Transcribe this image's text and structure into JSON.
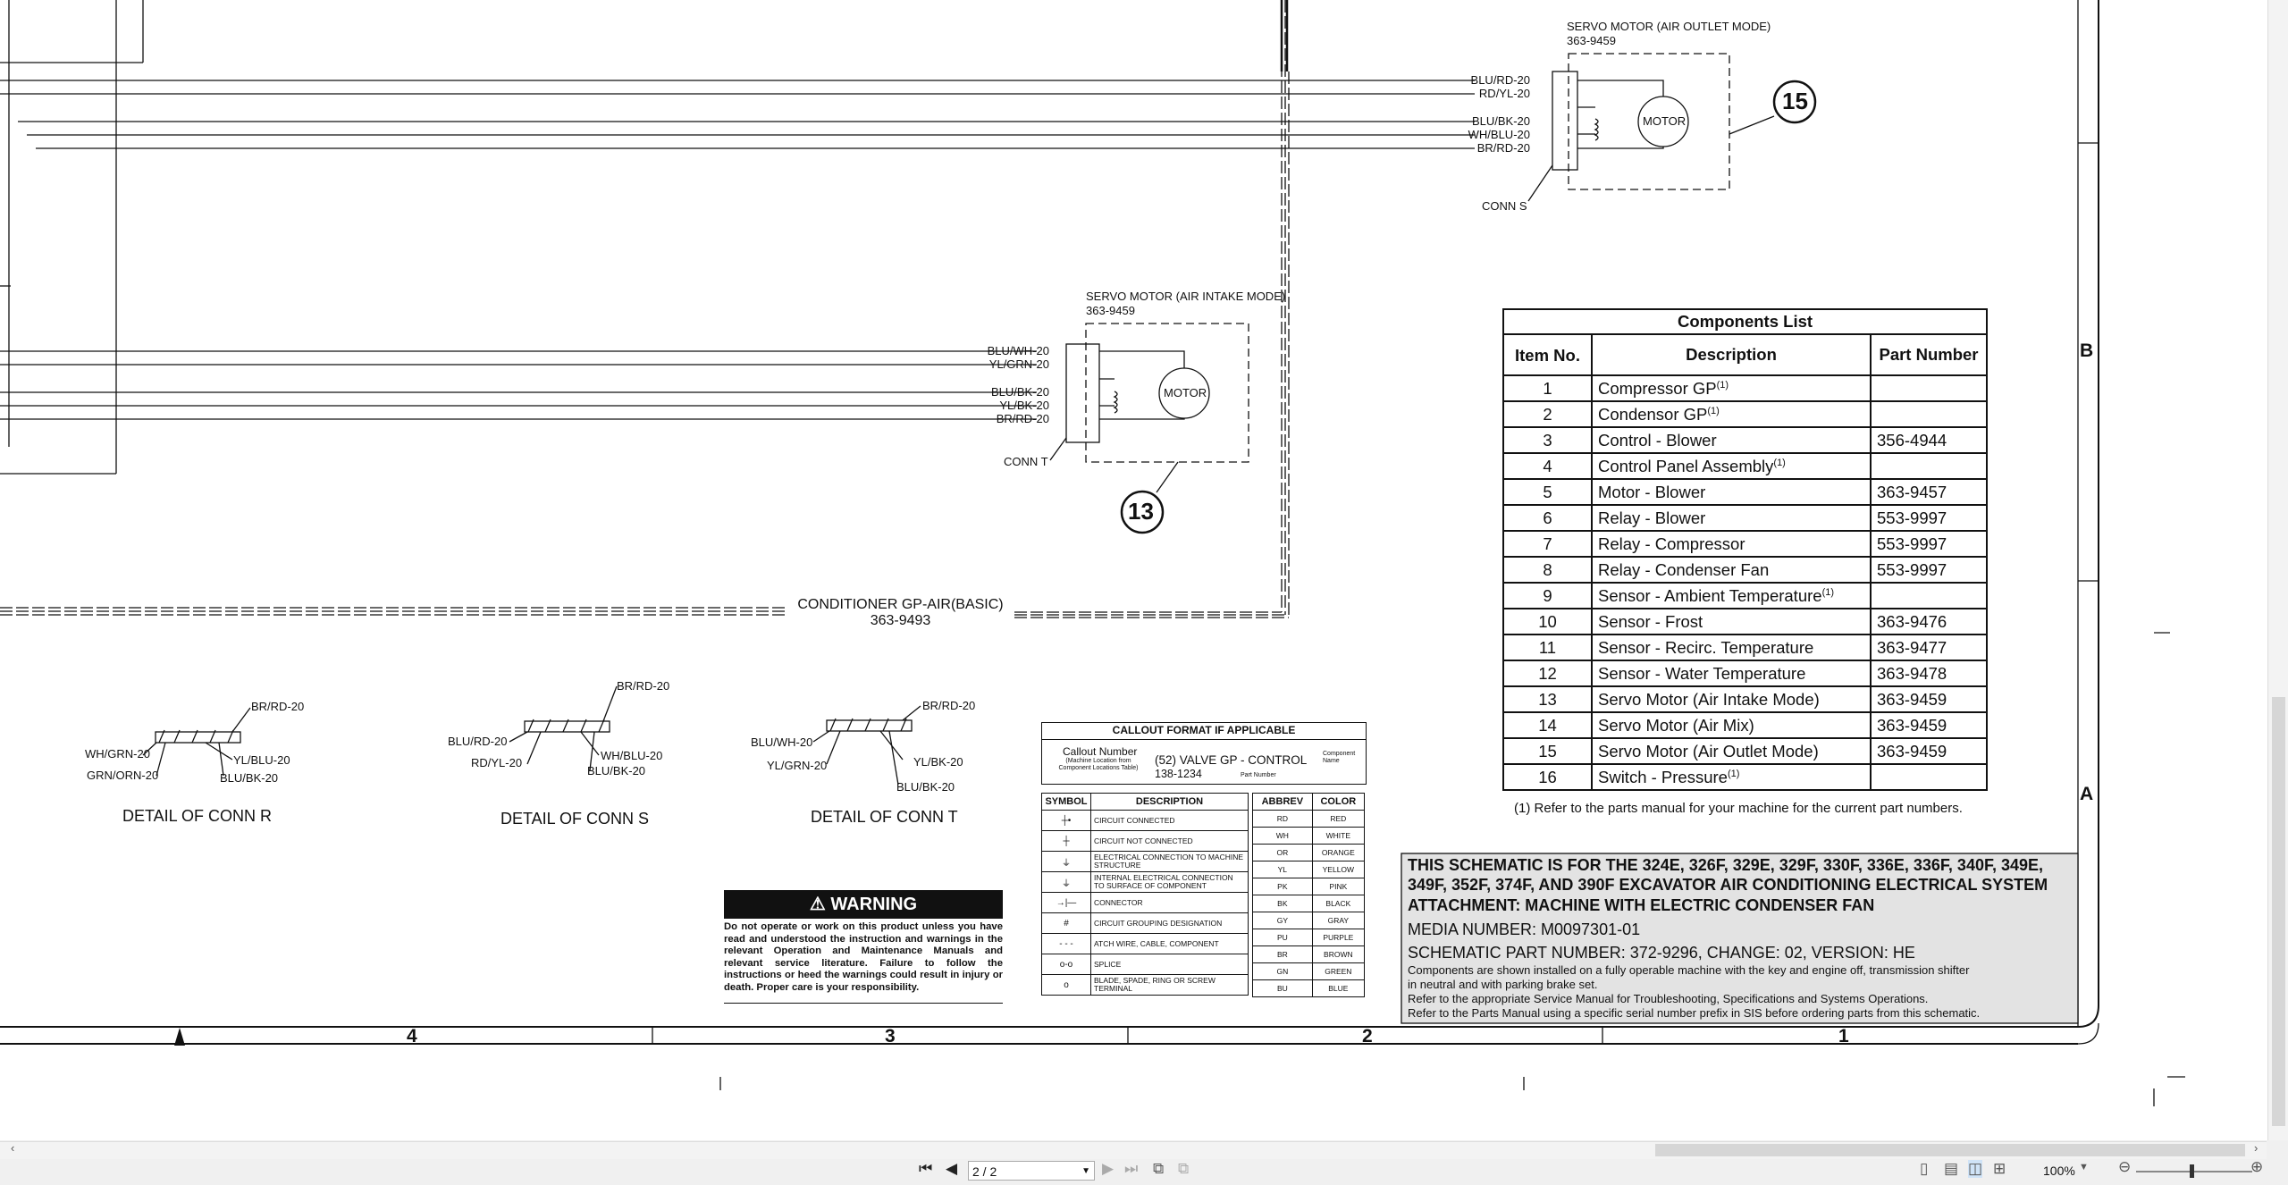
{
  "servo_outlet": {
    "title": "SERVO MOTOR (AIR OUTLET MODE)",
    "part": "363-9459",
    "wires": [
      "BLU/RD-20",
      "RD/YL-20",
      "BLU/BK-20",
      "WH/BLU-20",
      "BR/RD-20"
    ],
    "conn": "CONN S",
    "motor": "MOTOR",
    "callout": "15"
  },
  "servo_intake": {
    "title": "SERVO MOTOR (AIR INTAKE MODE)",
    "part": "363-9459",
    "wires": [
      "BLU/WH-20",
      "YL/GRN-20",
      "BLU/BK-20",
      "YL/BK-20",
      "BR/RD-20"
    ],
    "conn": "CONN T",
    "motor": "MOTOR",
    "callout": "13"
  },
  "conditioner": {
    "name": "CONDITIONER GP-AIR(BASIC)",
    "part": "363-9493"
  },
  "zone_labels": {
    "b": "B",
    "a": "A"
  },
  "column_numbers": [
    "4",
    "3",
    "2",
    "1"
  ],
  "details": {
    "r": {
      "title": "DETAIL OF CONN R",
      "wires": [
        "BR/RD-20",
        "WH/GRN-20",
        "YL/BLU-20",
        "GRN/ORN-20",
        "BLU/BK-20"
      ]
    },
    "s": {
      "title": "DETAIL OF CONN S",
      "wires": [
        "BR/RD-20",
        "BLU/RD-20",
        "WH/BLU-20",
        "RD/YL-20",
        "BLU/BK-20"
      ]
    },
    "t": {
      "title": "DETAIL OF CONN T",
      "wires": [
        "BR/RD-20",
        "BLU/WH-20",
        "YL/BK-20",
        "YL/GRN-20",
        "BLU/BK-20"
      ]
    }
  },
  "components": {
    "title": "Components List",
    "headers": [
      "Item No.",
      "Description",
      "Part Number"
    ],
    "rows": [
      {
        "no": "1",
        "desc": "Compressor GP",
        "sup": "(1)",
        "pn": ""
      },
      {
        "no": "2",
        "desc": "Condensor GP",
        "sup": "(1)",
        "pn": ""
      },
      {
        "no": "3",
        "desc": "Control - Blower",
        "sup": "",
        "pn": "356-4944"
      },
      {
        "no": "4",
        "desc": "Control Panel Assembly",
        "sup": "(1)",
        "pn": ""
      },
      {
        "no": "5",
        "desc": "Motor - Blower",
        "sup": "",
        "pn": "363-9457"
      },
      {
        "no": "6",
        "desc": "Relay - Blower",
        "sup": "",
        "pn": "553-9997"
      },
      {
        "no": "7",
        "desc": "Relay - Compressor",
        "sup": "",
        "pn": "553-9997"
      },
      {
        "no": "8",
        "desc": "Relay - Condenser Fan",
        "sup": "",
        "pn": "553-9997"
      },
      {
        "no": "9",
        "desc": "Sensor - Ambient Temperature",
        "sup": "(1)",
        "pn": ""
      },
      {
        "no": "10",
        "desc": "Sensor - Frost",
        "sup": "",
        "pn": "363-9476"
      },
      {
        "no": "11",
        "desc": "Sensor - Recirc. Temperature",
        "sup": "",
        "pn": "363-9477"
      },
      {
        "no": "12",
        "desc": "Sensor - Water Temperature",
        "sup": "",
        "pn": "363-9478"
      },
      {
        "no": "13",
        "desc": "Servo Motor (Air Intake Mode)",
        "sup": "",
        "pn": "363-9459"
      },
      {
        "no": "14",
        "desc": "Servo Motor (Air Mix)",
        "sup": "",
        "pn": "363-9459"
      },
      {
        "no": "15",
        "desc": "Servo Motor (Air Outlet Mode)",
        "sup": "",
        "pn": "363-9459"
      },
      {
        "no": "16",
        "desc": "Switch - Pressure",
        "sup": "(1)",
        "pn": ""
      }
    ],
    "footnote": "(1) Refer to the parts manual for your machine for the current part numbers."
  },
  "callout_format": {
    "title": "CALLOUT FORMAT IF APPLICABLE",
    "callout_number": "Callout Number",
    "callout_note": "(Machine Location from Component Locations Table)",
    "example": "(52) VALVE GP - CONTROL",
    "example_part": "138-1234",
    "component_name": "Component Name",
    "part_number": "Part Number"
  },
  "symbols": {
    "headers": [
      "SYMBOL",
      "DESCRIPTION"
    ],
    "rows": [
      "CIRCUIT CONNECTED",
      "CIRCUIT NOT CONNECTED",
      "ELECTRICAL CONNECTION TO MACHINE STRUCTURE",
      "INTERNAL ELECTRICAL CONNECTION TO SURFACE OF COMPONENT",
      "CONNECTOR",
      "CIRCUIT GROUPING DESIGNATION",
      "ATCH WIRE, CABLE, COMPONENT",
      "SPLICE",
      "BLADE, SPADE, RING OR SCREW TERMINAL"
    ]
  },
  "colors_table": {
    "headers": [
      "ABBREV",
      "COLOR"
    ],
    "rows": [
      [
        "RD",
        "RED"
      ],
      [
        "WH",
        "WHITE"
      ],
      [
        "OR",
        "ORANGE"
      ],
      [
        "YL",
        "YELLOW"
      ],
      [
        "PK",
        "PINK"
      ],
      [
        "BK",
        "BLACK"
      ],
      [
        "GY",
        "GRAY"
      ],
      [
        "PU",
        "PURPLE"
      ],
      [
        "BR",
        "BROWN"
      ],
      [
        "GN",
        "GREEN"
      ],
      [
        "BU",
        "BLUE"
      ]
    ]
  },
  "warning": {
    "title": "WARNING",
    "text": "Do not operate or work on this product unless you have read and understood the instruction and warnings in the relevant Operation and Maintenance Manuals and relevant service literature. Failure to follow the instructions or heed the warnings could result in injury or death. Proper care is your responsibility."
  },
  "title_block": {
    "heading": "THIS SCHEMATIC IS FOR THE 324E, 326F, 329E, 329F, 330F, 336E, 336F, 340F, 349E, 349F, 352F, 374F, AND 390F EXCAVATOR AIR CONDITIONING ELECTRICAL SYSTEM",
    "attachment": "ATTACHMENT: MACHINE WITH ELECTRIC CONDENSER FAN",
    "media": "MEDIA NUMBER: M0097301-01",
    "schematic": "SCHEMATIC PART NUMBER: 372-9296, CHANGE: 02, VERSION: HE",
    "note1": "Components are shown installed on a fully operable machine with the key and engine off, transmission shifter",
    "note2": "in neutral and with parking brake set.",
    "note3": "Refer to the appropriate Service Manual for Troubleshooting, Specifications and Systems Operations.",
    "note4": "Refer to the Parts Manual using a specific serial number prefix in SIS before ordering parts from this schematic."
  },
  "viewer": {
    "page_value": "2 / 2",
    "zoom": "100%",
    "icons": [
      "first-page-icon",
      "prev-page-icon",
      "next-page-icon",
      "last-page-icon",
      "previous-view-icon",
      "next-view-icon",
      "single-page-icon",
      "continuous-icon",
      "two-page-icon",
      "two-page-continuous-icon",
      "zoom-out-icon",
      "zoom-in-icon"
    ]
  }
}
